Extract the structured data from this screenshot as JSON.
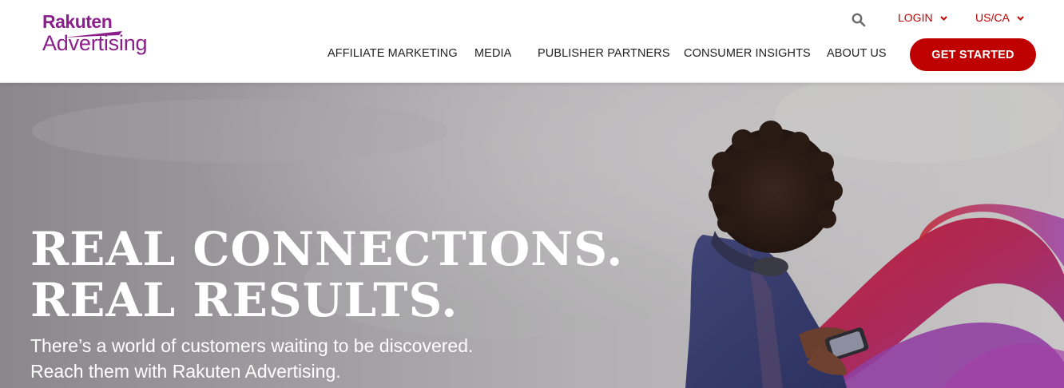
{
  "header": {
    "logo": {
      "line1": "Rakuten",
      "line2": "Advertising"
    },
    "utility": {
      "search_icon": "search-icon",
      "login_label": "LOGIN",
      "region_label": "US/CA"
    },
    "nav": [
      {
        "label": "AFFILIATE MARKETING"
      },
      {
        "label": "MEDIA"
      },
      {
        "label": "PUBLISHER PARTNERS"
      },
      {
        "label": "CONSUMER INSIGHTS"
      },
      {
        "label": "ABOUT US"
      }
    ],
    "cta_label": "GET STARTED"
  },
  "hero": {
    "headline_line1": "REAL CONNECTIONS.",
    "headline_line2": "REAL RESULTS.",
    "subtext_line1": "There’s a world of customers waiting to be discovered.",
    "subtext_line2": "Reach them with Rakuten Advertising."
  },
  "colors": {
    "brand_purple": "#8b1f8c",
    "accent_red": "#bf0000",
    "nav_text": "#222222",
    "hero_text": "#ffffff"
  }
}
